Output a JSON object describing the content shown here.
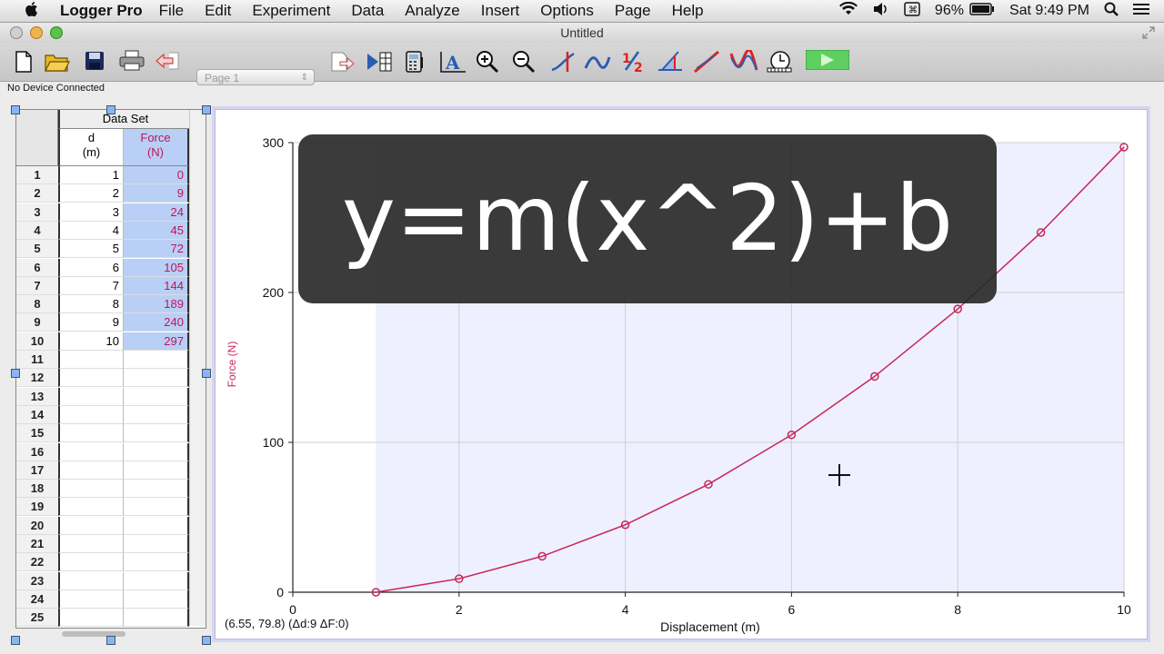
{
  "menubar": {
    "apple_icon": "",
    "app_name": "Logger Pro",
    "items": [
      "File",
      "Edit",
      "Experiment",
      "Data",
      "Analyze",
      "Insert",
      "Options",
      "Page",
      "Help"
    ],
    "battery": "96%",
    "clock": "Sat 9:49 PM"
  },
  "window": {
    "title": "Untitled",
    "page_selector": "Page 1",
    "status": "No Device Connected"
  },
  "table": {
    "dataset": "Data Set",
    "col_d_name": "d",
    "col_d_unit": "(m)",
    "col_f_name": "Force",
    "col_f_unit": "(N)",
    "rows": [
      {
        "n": "1",
        "d": "1",
        "f": "0"
      },
      {
        "n": "2",
        "d": "2",
        "f": "9"
      },
      {
        "n": "3",
        "d": "3",
        "f": "24"
      },
      {
        "n": "4",
        "d": "4",
        "f": "45"
      },
      {
        "n": "5",
        "d": "5",
        "f": "72"
      },
      {
        "n": "6",
        "d": "6",
        "f": "105"
      },
      {
        "n": "7",
        "d": "7",
        "f": "144"
      },
      {
        "n": "8",
        "d": "8",
        "f": "189"
      },
      {
        "n": "9",
        "d": "9",
        "f": "240"
      },
      {
        "n": "10",
        "d": "10",
        "f": "297"
      },
      {
        "n": "11",
        "d": "",
        "f": ""
      },
      {
        "n": "12",
        "d": "",
        "f": ""
      },
      {
        "n": "13",
        "d": "",
        "f": ""
      },
      {
        "n": "14",
        "d": "",
        "f": ""
      },
      {
        "n": "15",
        "d": "",
        "f": ""
      },
      {
        "n": "16",
        "d": "",
        "f": ""
      },
      {
        "n": "17",
        "d": "",
        "f": ""
      },
      {
        "n": "18",
        "d": "",
        "f": ""
      },
      {
        "n": "19",
        "d": "",
        "f": ""
      },
      {
        "n": "20",
        "d": "",
        "f": ""
      },
      {
        "n": "21",
        "d": "",
        "f": ""
      },
      {
        "n": "22",
        "d": "",
        "f": ""
      },
      {
        "n": "23",
        "d": "",
        "f": ""
      },
      {
        "n": "24",
        "d": "",
        "f": ""
      },
      {
        "n": "25",
        "d": "",
        "f": ""
      }
    ]
  },
  "graph": {
    "coord_readout": "(6.55, 79.8) (Δd:9 ΔF:0)",
    "overlay_text": "y=m(x^2)+b"
  },
  "chart_data": {
    "type": "line",
    "xlabel": "Displacement (m)",
    "ylabel": "Force (N)",
    "xlim": [
      0,
      10
    ],
    "ylim": [
      0,
      300
    ],
    "xticks": [
      0,
      2,
      4,
      6,
      8,
      10
    ],
    "yticks": [
      0,
      100,
      200,
      300
    ],
    "grid": true,
    "x": [
      1,
      2,
      3,
      4,
      5,
      6,
      7,
      8,
      9,
      10
    ],
    "y": [
      0,
      9,
      24,
      45,
      72,
      105,
      144,
      189,
      240,
      297
    ],
    "selection_range": [
      1,
      10
    ],
    "colors": {
      "series": "#c8285a",
      "selection": "#eef0ff",
      "grid": "#cfcfcf"
    }
  }
}
